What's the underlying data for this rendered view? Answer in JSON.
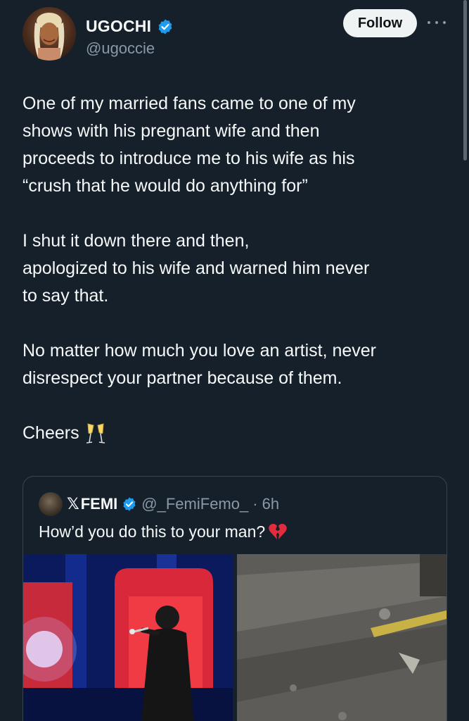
{
  "author": {
    "display_name": "UGOCHI",
    "handle": "@ugoccie",
    "verified": true,
    "avatar": "profile-photo"
  },
  "actions": {
    "follow_label": "Follow",
    "more_icon": "more-dots-icon"
  },
  "tweet": {
    "paragraphs": [
      "One of my married fans came to one of my\nshows with his pregnant wife and then\nproceeds to introduce me to his wife as his\n“crush that he would do anything for”",
      "I shut it down there and then,\napologized to his wife and warned him never\nto say that.",
      "No matter how much you love an artist, never\ndisrespect your partner because of them."
    ],
    "closing": "Cheers",
    "closing_emoji": "champagne-glasses-icon"
  },
  "quote": {
    "x_prefix": "𝕏",
    "display_name": "FEMI",
    "verified": true,
    "handle": "@_FemiFemo_",
    "time": "· 6h",
    "text": "How’d you do this to your man?",
    "text_emoji": "broken-heart-icon",
    "media": [
      {
        "name": "stage-performance-photo"
      },
      {
        "name": "street-ground-photo"
      }
    ]
  },
  "colors": {
    "background": "#15202b",
    "text": "#f7f9f9",
    "secondary_text": "#8b98a5",
    "verified_blue": "#1d9bf0",
    "border": "#38444d",
    "follow_bg": "#eff3f4"
  }
}
